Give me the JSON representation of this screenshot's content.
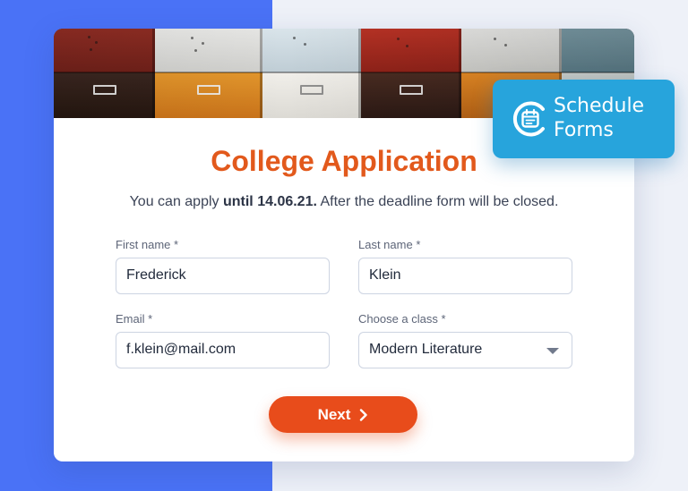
{
  "form": {
    "title": "College Application",
    "subtitle_prefix": "You can apply ",
    "subtitle_deadline": "until 14.06.21.",
    "subtitle_suffix": " After the deadline form will be closed.",
    "fields": {
      "first_name": {
        "label": "First name *",
        "value": "Frederick"
      },
      "last_name": {
        "label": "Last name *",
        "value": "Klein"
      },
      "email": {
        "label": "Email *",
        "value": "f.klein@mail.com"
      },
      "class": {
        "label": "Choose a class *",
        "value": "Modern Literature"
      }
    },
    "next_button": {
      "label": "Next"
    }
  },
  "badge": {
    "line1": "Schedule",
    "line2": "Forms",
    "icon": "calendar-icon"
  },
  "colors": {
    "accent": "#e84c1b",
    "title": "#e2591c",
    "badge": "#27a4dc",
    "background_blue": "#4a72f6"
  }
}
